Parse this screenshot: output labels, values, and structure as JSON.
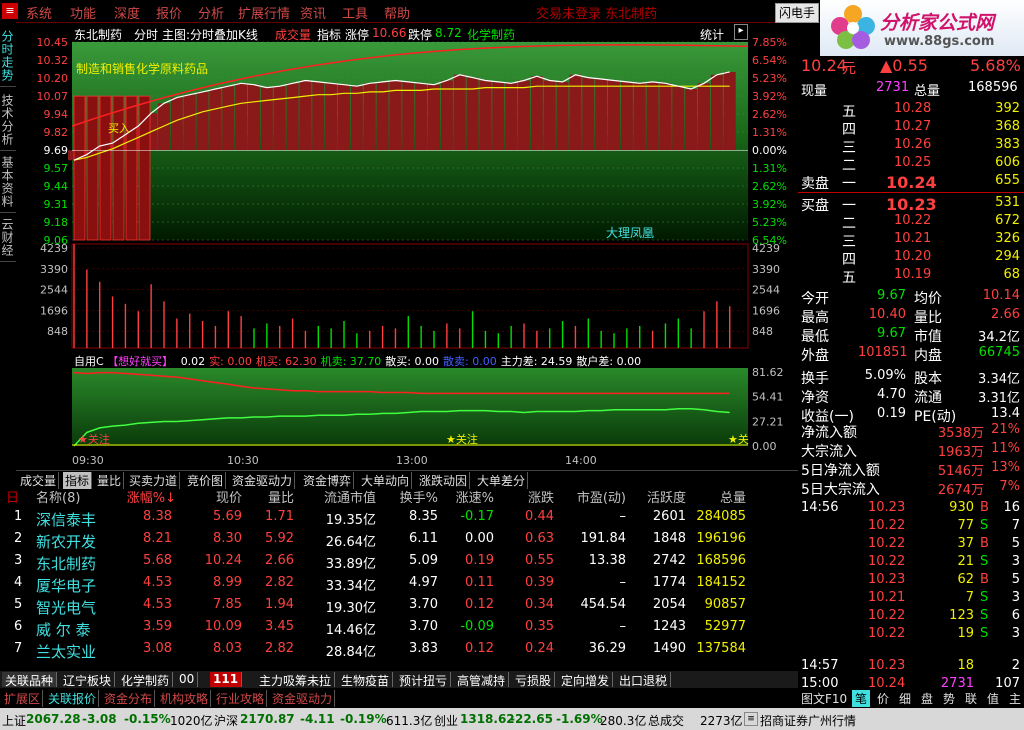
{
  "menu": {
    "items": [
      "系统",
      "功能",
      "深度",
      "报价",
      "分析",
      "扩展行情",
      "资讯",
      "工具",
      "帮助"
    ],
    "center_note": "交易未登录   东北制药",
    "flash_btn": "闪电手",
    "logo": "分析家公式网",
    "logo_url": "www.88gs.com"
  },
  "left_tabs": [
    "分时走势",
    "技术分析",
    "基本资料",
    "云财经"
  ],
  "chart_header": {
    "stock": "东北制药",
    "items": [
      "分时",
      "主图:分时叠加K线",
      "成交量",
      "指标"
    ],
    "up_label": "涨停",
    "up_val": "10.66",
    "down_label": "跌停",
    "down_val": "8.72",
    "sector": "化学制药",
    "stats": "统计"
  },
  "chart_notes": {
    "concept": "制造和销售化学原料药品",
    "signal": "买入",
    "region": "大理凤凰",
    "ind_label": "自用C",
    "ind_title": "【想好就买】",
    "ind_vals": [
      {
        "k": "0.02",
        "c": "#fff"
      },
      {
        "k": "实: 0.00",
        "c": "#ff4040"
      },
      {
        "k": "机买: 62.30",
        "c": "#ff4040"
      },
      {
        "k": "机卖: 37.70",
        "c": "#00e000"
      },
      {
        "k": "散买: 0.00",
        "c": "#fff"
      },
      {
        "k": "散卖: 0.00",
        "c": "#4060ff"
      },
      {
        "k": "主力差: 24.59",
        "c": "#fff"
      },
      {
        "k": "散户差: 0.00",
        "c": "#fff"
      }
    ],
    "star1": "★关注",
    "star2": "★关注",
    "star3": "★关"
  },
  "price_axis_left": [
    "10.45",
    "10.32",
    "10.20",
    "10.07",
    "9.94",
    "9.82",
    "9.69",
    "9.57",
    "9.44",
    "9.31",
    "9.18",
    "9.06"
  ],
  "price_axis_right": [
    "7.85%",
    "6.54%",
    "5.23%",
    "3.92%",
    "2.62%",
    "1.31%",
    "0.00%",
    "1.31%",
    "2.62%",
    "3.92%",
    "5.23%",
    "6.54%"
  ],
  "vol_axis": [
    "4239",
    "3390",
    "2544",
    "1696",
    "848"
  ],
  "ind_axis": [
    "81.62",
    "54.41",
    "27.21",
    "0.00"
  ],
  "time_axis": [
    "09:30",
    "10:30",
    "13:00",
    "14:00"
  ],
  "chart_data": {
    "type": "line",
    "price_line": [
      9.62,
      9.66,
      9.72,
      9.74,
      9.8,
      9.86,
      9.95,
      10.02,
      10.06,
      10.08,
      10.1,
      10.12,
      10.14,
      10.16,
      10.15,
      10.13,
      10.14,
      10.16,
      10.18,
      10.17,
      10.16,
      10.15,
      10.14,
      10.16,
      10.17,
      10.18,
      10.17,
      10.16,
      10.15,
      10.18,
      10.22,
      10.2,
      10.18,
      10.17,
      10.16,
      10.18,
      10.21,
      10.18,
      10.17,
      10.22,
      10.2,
      10.19,
      10.18,
      10.17,
      10.16,
      10.17,
      10.16,
      10.14,
      10.12,
      10.16,
      10.22,
      10.24
    ],
    "avg_line": [
      9.62,
      9.64,
      9.67,
      9.7,
      9.74,
      9.78,
      9.82,
      9.86,
      9.9,
      9.93,
      9.96,
      9.98,
      10.0,
      10.02,
      10.03,
      10.04,
      10.05,
      10.06,
      10.07,
      10.08,
      10.08,
      10.09,
      10.09,
      10.1,
      10.1,
      10.11,
      10.11,
      10.11,
      10.12,
      10.12,
      10.12,
      10.12,
      10.13,
      10.13,
      10.13,
      10.13,
      10.14,
      10.14,
      10.14,
      10.14,
      10.14,
      10.14,
      10.14,
      10.14,
      10.14,
      10.14,
      10.14,
      10.14,
      10.14,
      10.14,
      10.14,
      10.14
    ],
    "volume": [
      4239,
      3200,
      2700,
      2100,
      1800,
      1500,
      2600,
      1900,
      1200,
      1400,
      1100,
      900,
      1500,
      1300,
      800,
      1000,
      900,
      1200,
      700,
      900,
      800,
      1100,
      600,
      700,
      900,
      800,
      1300,
      900,
      700,
      1000,
      800,
      1500,
      700,
      600,
      900,
      1000,
      700,
      800,
      1100,
      900,
      1200,
      700,
      600,
      800,
      900,
      700,
      1000,
      1200,
      800,
      1500,
      1900,
      1700
    ],
    "ind_red": [
      81,
      80,
      81,
      81,
      80,
      79,
      78,
      77,
      76,
      74,
      72,
      70,
      68,
      66,
      64,
      63,
      62,
      61,
      61,
      60,
      60,
      60,
      60,
      60,
      59,
      59,
      59,
      58,
      58,
      58,
      58,
      58,
      58,
      58,
      58,
      58,
      58,
      58,
      58,
      58,
      58,
      58,
      58,
      58,
      58,
      58,
      58,
      58,
      58,
      58,
      58,
      58
    ],
    "ind_green": [
      0,
      15,
      20,
      22,
      23,
      25,
      26,
      27,
      27,
      28,
      29,
      30,
      31,
      31,
      32,
      32,
      33,
      33,
      33,
      34,
      34,
      34,
      35,
      35,
      36,
      36,
      37,
      38,
      38,
      38,
      39,
      39,
      39,
      38,
      38,
      37,
      38,
      38,
      38,
      38,
      39,
      39,
      40,
      40,
      40,
      40,
      40,
      41,
      41,
      40,
      38,
      37
    ]
  },
  "quote": {
    "price": "10.24",
    "unit": "元",
    "change": "▲0.55",
    "pct": "5.68%",
    "now_vol_label": "现量",
    "now_vol": "2731",
    "total_vol_label": "总量",
    "total_vol": "168596",
    "asks": [
      {
        "lv": "五",
        "p": "10.28",
        "v": "392"
      },
      {
        "lv": "四",
        "p": "10.27",
        "v": "368"
      },
      {
        "lv": "三",
        "p": "10.26",
        "v": "383"
      },
      {
        "lv": "二",
        "p": "10.25",
        "v": "606"
      },
      {
        "lv": "一",
        "p": "10.24",
        "v": "655"
      }
    ],
    "ask_label": "卖盘",
    "bid_label": "买盘",
    "bids": [
      {
        "lv": "一",
        "p": "10.23",
        "v": "531"
      },
      {
        "lv": "二",
        "p": "10.22",
        "v": "672"
      },
      {
        "lv": "三",
        "p": "10.21",
        "v": "326"
      },
      {
        "lv": "四",
        "p": "10.20",
        "v": "294"
      },
      {
        "lv": "五",
        "p": "10.19",
        "v": "68"
      }
    ],
    "stats": [
      {
        "l1": "今开",
        "v1": "9.67",
        "c1": "grn",
        "l2": "均价",
        "v2": "10.14",
        "c2": "red"
      },
      {
        "l1": "最高",
        "v1": "10.40",
        "c1": "red",
        "l2": "量比",
        "v2": "2.66",
        "c2": "red"
      },
      {
        "l1": "最低",
        "v1": "9.67",
        "c1": "grn",
        "l2": "市值",
        "v2": "34.2亿",
        "c2": "wht"
      },
      {
        "l1": "外盘",
        "v1": "101851",
        "c1": "red",
        "l2": "内盘",
        "v2": "66745",
        "c2": "grn"
      },
      {
        "l1": "换手",
        "v1": "5.09%",
        "c1": "wht",
        "l2": "股本",
        "v2": "3.34亿",
        "c2": "wht"
      },
      {
        "l1": "净资",
        "v1": "4.70",
        "c1": "wht",
        "l2": "流通",
        "v2": "3.31亿",
        "c2": "wht"
      },
      {
        "l1": "收益(一)",
        "v1": "0.19",
        "c1": "wht",
        "l2": "PE(动)",
        "v2": "13.4",
        "c2": "wht"
      }
    ],
    "flows": [
      {
        "l": "净流入额",
        "v": "3538万",
        "p": "21%"
      },
      {
        "l": "大宗流入",
        "v": "1963万",
        "p": "11%"
      },
      {
        "l": "5日净流入额",
        "v": "5146万",
        "p": "13%"
      },
      {
        "l": "5日大宗流入",
        "v": "2674万",
        "p": "7%"
      }
    ],
    "ticks": [
      {
        "t": "14:56",
        "p": "10.23",
        "v": "930",
        "s": "B",
        "n": "16",
        "pc": "red"
      },
      {
        "t": "",
        "p": "10.22",
        "v": "77",
        "s": "S",
        "n": "7",
        "pc": "red"
      },
      {
        "t": "",
        "p": "10.22",
        "v": "37",
        "s": "B",
        "n": "5",
        "pc": "red"
      },
      {
        "t": "",
        "p": "10.22",
        "v": "21",
        "s": "S",
        "n": "3",
        "pc": "red"
      },
      {
        "t": "",
        "p": "10.23",
        "v": "62",
        "s": "B",
        "n": "5",
        "pc": "red"
      },
      {
        "t": "",
        "p": "10.21",
        "v": "7",
        "s": "S",
        "n": "3",
        "pc": "red"
      },
      {
        "t": "",
        "p": "10.22",
        "v": "123",
        "s": "S",
        "n": "6",
        "pc": "red"
      },
      {
        "t": "",
        "p": "10.22",
        "v": "19",
        "s": "S",
        "n": "3",
        "pc": "red"
      },
      {
        "t": "14:57",
        "p": "10.23",
        "v": "18",
        "s": "",
        "n": "2",
        "pc": "red"
      },
      {
        "t": "15:00",
        "p": "10.24",
        "v": "2731",
        "s": "",
        "n": "107",
        "pc": "red"
      }
    ]
  },
  "tool_tabs": [
    "成交量",
    "指标",
    "量比",
    "买卖力道",
    "竞价图",
    "资金驱动力",
    "资金博弈",
    "大单动向",
    "涨跌动因",
    "大单差分"
  ],
  "table": {
    "headers": [
      "名称(8)",
      "涨幅%↓",
      "现价",
      "量比",
      "流通市值",
      "换手%",
      "涨速%",
      "涨跌",
      "市盈(动)",
      "活跃度",
      "总量"
    ],
    "rows": [
      {
        "i": "1",
        "name": "深信泰丰",
        "chg": "8.38",
        "price": "5.69",
        "lb": "1.71",
        "mv": "19.35亿",
        "hs": "8.35",
        "zs": "-0.17",
        "zd": "0.44",
        "pe": "–",
        "hy": "2601",
        "vol": "284085"
      },
      {
        "i": "2",
        "name": "新农开发",
        "chg": "8.21",
        "price": "8.30",
        "lb": "5.92",
        "mv": "26.64亿",
        "hs": "6.11",
        "zs": "0.00",
        "zd": "0.63",
        "pe": "191.84",
        "hy": "1848",
        "vol": "196196"
      },
      {
        "i": "3",
        "name": "东北制药",
        "chg": "5.68",
        "price": "10.24",
        "lb": "2.66",
        "mv": "33.89亿",
        "hs": "5.09",
        "zs": "0.19",
        "zd": "0.55",
        "pe": "13.38",
        "hy": "2742",
        "vol": "168596"
      },
      {
        "i": "4",
        "name": "厦华电子",
        "chg": "4.53",
        "price": "8.99",
        "lb": "2.82",
        "mv": "33.34亿",
        "hs": "4.97",
        "zs": "0.11",
        "zd": "0.39",
        "pe": "–",
        "hy": "1774",
        "vol": "184152"
      },
      {
        "i": "5",
        "name": "智光电气",
        "chg": "4.53",
        "price": "7.85",
        "lb": "1.94",
        "mv": "19.30亿",
        "hs": "3.70",
        "zs": "0.12",
        "zd": "0.34",
        "pe": "454.54",
        "hy": "2054",
        "vol": "90857"
      },
      {
        "i": "6",
        "name": "威 尔 泰",
        "chg": "3.59",
        "price": "10.09",
        "lb": "3.45",
        "mv": "14.46亿",
        "hs": "3.70",
        "zs": "-0.09",
        "zd": "0.35",
        "pe": "–",
        "hy": "1243",
        "vol": "52977"
      },
      {
        "i": "7",
        "name": "兰太实业",
        "chg": "3.08",
        "price": "8.03",
        "lb": "2.82",
        "mv": "28.84亿",
        "hs": "3.83",
        "zs": "0.12",
        "zd": "0.24",
        "pe": "36.29",
        "hy": "1490",
        "vol": "137584"
      }
    ]
  },
  "stock_tabs": [
    "关联品种",
    "辽宁板块",
    "化学制药",
    "00",
    "111",
    "主力吸筹未拉",
    "生物疫苗",
    "预计扭亏",
    "高管减持",
    "亏损股",
    "定向增发",
    "出口退税"
  ],
  "sub_tabs": [
    "扩展区",
    "关联报价",
    "资金分布",
    "机构攻略",
    "行业攻略",
    "资金驱动力"
  ],
  "right_tabs": {
    "label": "图文F10",
    "items": [
      "笔",
      "价",
      "细",
      "盘",
      "势",
      "联",
      "值",
      "主"
    ]
  },
  "status": {
    "sh_label": "上证",
    "sh": "2067.28",
    "sh_chg": "-3.08",
    "sh_pct": "-0.15%",
    "sh_amt": "1020亿",
    "sz_label": "沪深",
    "sz": "2170.87",
    "sz_chg": "-4.11",
    "sz_pct": "-0.19%",
    "sz_amt": "611.3亿",
    "cy_label": "创业",
    "cy": "1318.62",
    "cy_chg": "-22.65",
    "cy_pct": "-1.69%",
    "cy_amt": "280.3亿",
    "total_label": "总成交",
    "total": "2273亿",
    "broker": "招商证券广州行情"
  }
}
